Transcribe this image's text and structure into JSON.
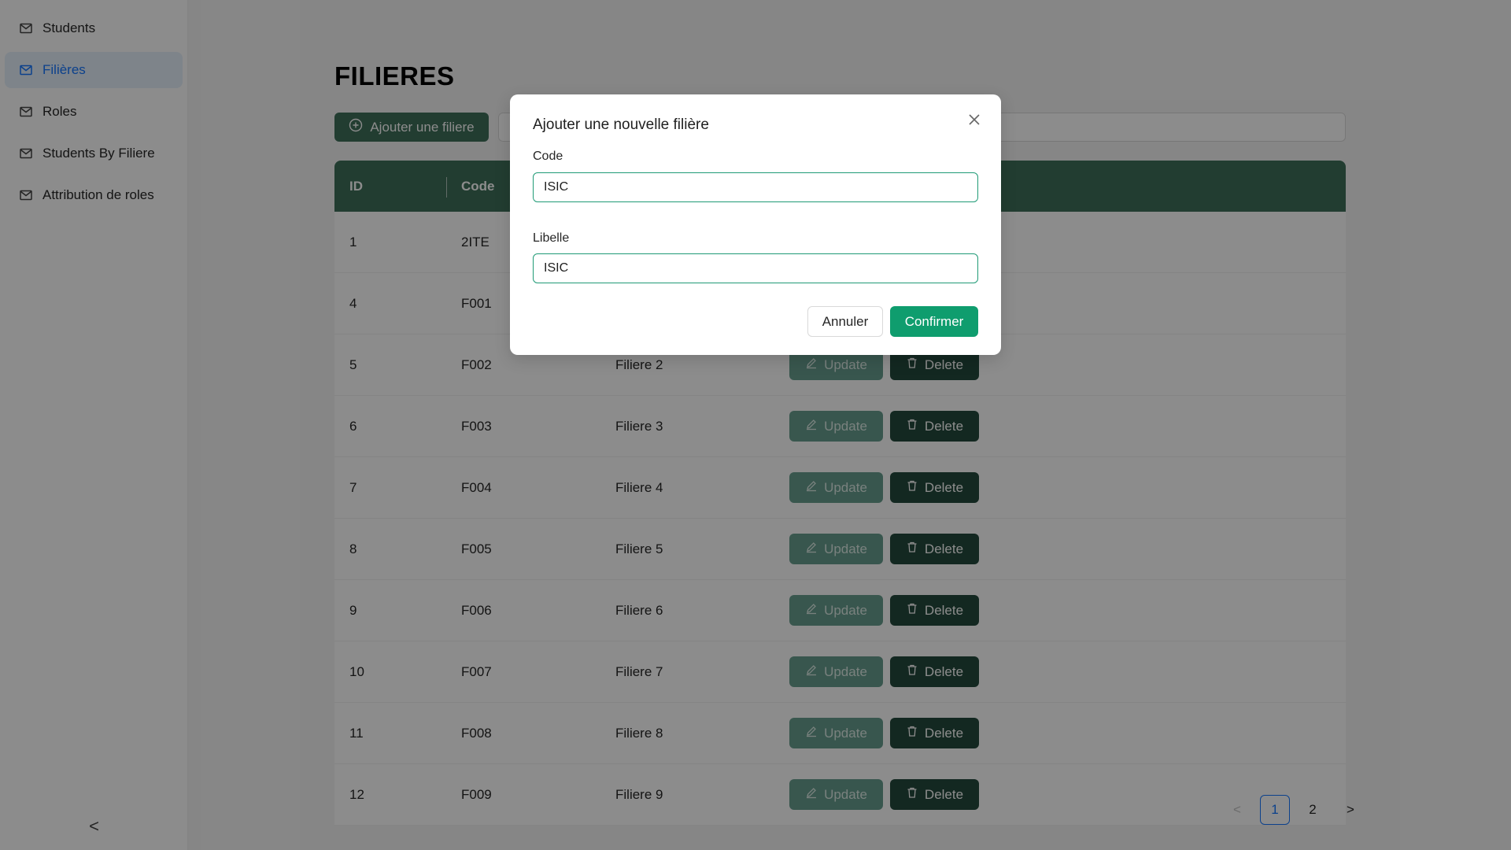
{
  "sidebar": {
    "items": [
      {
        "label": "Students",
        "icon": "mail-icon",
        "active": false
      },
      {
        "label": "Filières",
        "icon": "mail-icon",
        "active": true
      },
      {
        "label": "Roles",
        "icon": "mail-icon",
        "active": false
      },
      {
        "label": "Students By Filiere",
        "icon": "mail-icon",
        "active": false
      },
      {
        "label": "Attribution de roles",
        "icon": "mail-icon",
        "active": false
      }
    ],
    "collapse_glyph": "<"
  },
  "page": {
    "title": "FILIERES",
    "add_button_label": "Ajouter une filiere"
  },
  "table": {
    "columns": [
      "ID",
      "Code"
    ],
    "rows": [
      {
        "id": "1",
        "code": "2ITE",
        "libelle": ""
      },
      {
        "id": "4",
        "code": "F001",
        "libelle": ""
      },
      {
        "id": "5",
        "code": "F002",
        "libelle": "Filiere 2"
      },
      {
        "id": "6",
        "code": "F003",
        "libelle": "Filiere 3"
      },
      {
        "id": "7",
        "code": "F004",
        "libelle": "Filiere 4"
      },
      {
        "id": "8",
        "code": "F005",
        "libelle": "Filiere 5"
      },
      {
        "id": "9",
        "code": "F006",
        "libelle": "Filiere 6"
      },
      {
        "id": "10",
        "code": "F007",
        "libelle": "Filiere 7"
      },
      {
        "id": "11",
        "code": "F008",
        "libelle": "Filiere 8"
      },
      {
        "id": "12",
        "code": "F009",
        "libelle": "Filiere 9"
      }
    ],
    "update_label": "Update",
    "delete_label": "Delete"
  },
  "pagination": {
    "prev": "<",
    "pages": [
      "1",
      "2"
    ],
    "current": "1",
    "next": ">"
  },
  "modal": {
    "title": "Ajouter une nouvelle filière",
    "code_label": "Code",
    "code_value": "ISIC",
    "libelle_label": "Libelle",
    "libelle_value": "ISIC",
    "cancel_label": "Annuler",
    "confirm_label": "Confirmer"
  },
  "colors": {
    "primary_green": "#3f6f5a",
    "confirm_green": "#0f9d6e",
    "active_blue": "#1677ff"
  }
}
